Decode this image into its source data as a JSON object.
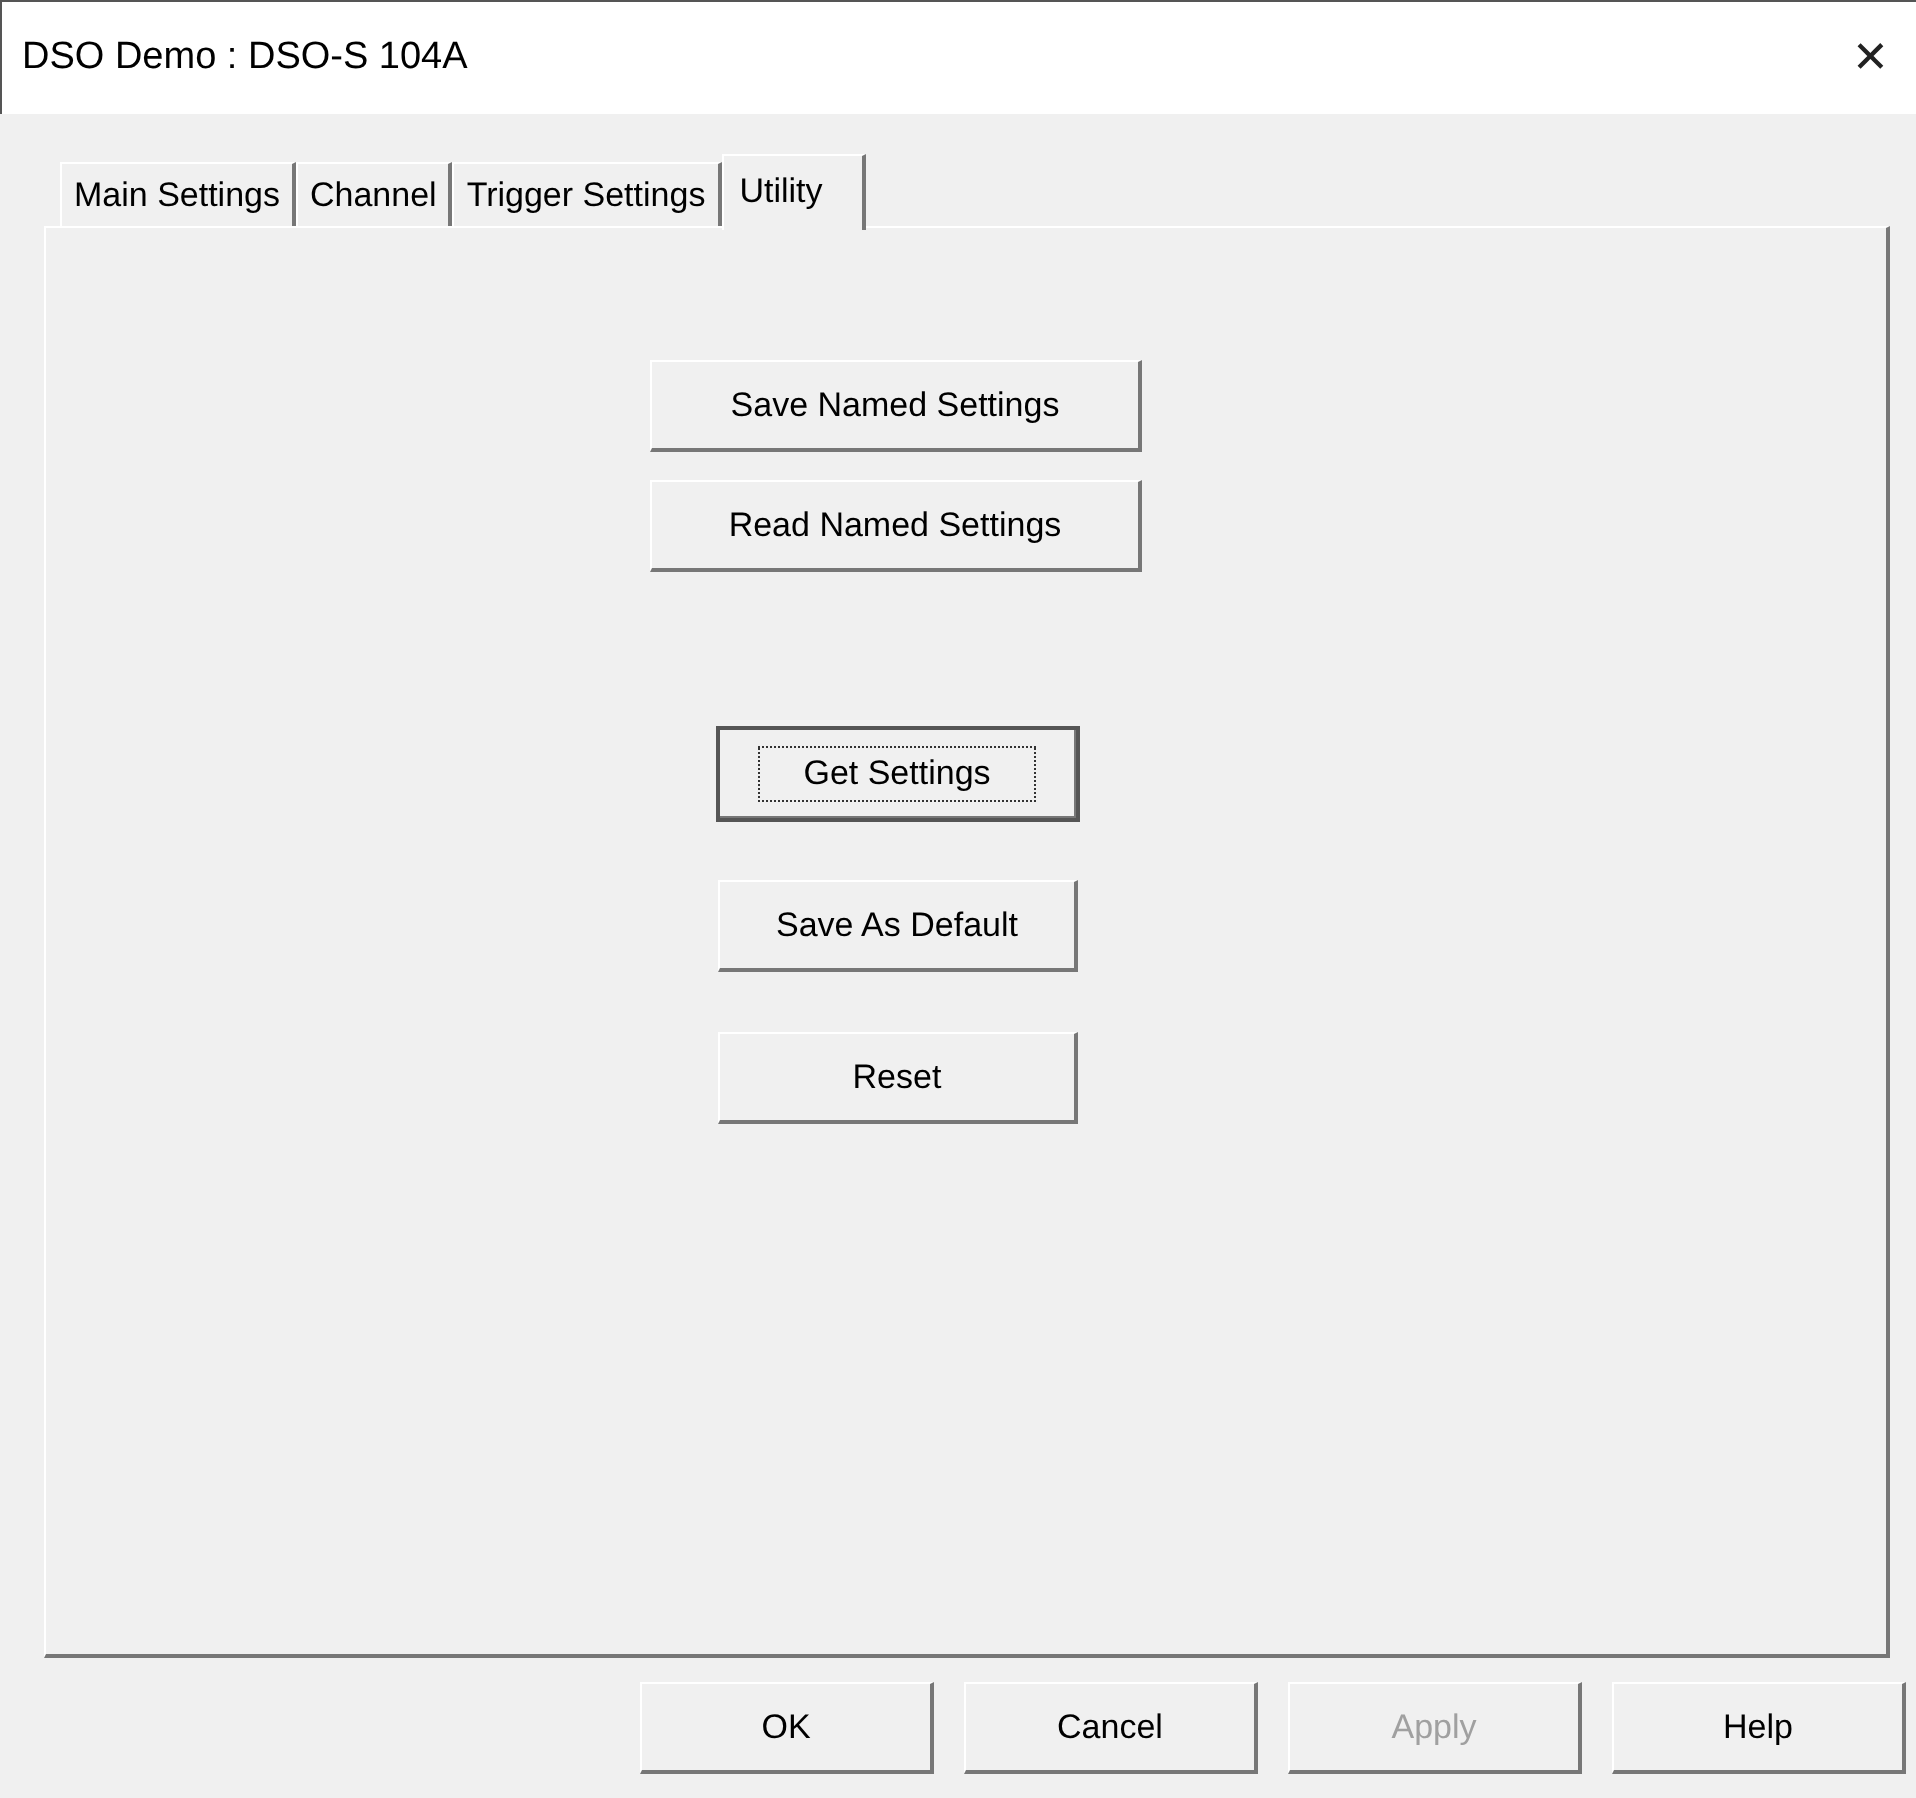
{
  "window": {
    "title": "DSO Demo : DSO-S 104A",
    "close": "✕"
  },
  "tabs": [
    {
      "label": "Main Settings",
      "selected": false
    },
    {
      "label": "Channel",
      "selected": false
    },
    {
      "label": "Trigger Settings",
      "selected": false
    },
    {
      "label": "Utility",
      "selected": true
    }
  ],
  "panel_buttons": [
    {
      "label": "Save Named Settings",
      "kind": "wide",
      "focused": false
    },
    {
      "label": "Read Named Settings",
      "kind": "wide",
      "focused": false
    },
    {
      "label": "Get Settings",
      "kind": "narrow",
      "focused": true
    },
    {
      "label": "Save As Default",
      "kind": "narrow",
      "focused": false
    },
    {
      "label": "Reset",
      "kind": "narrow",
      "focused": false
    }
  ],
  "dialog_buttons": [
    {
      "label": "OK",
      "disabled": false
    },
    {
      "label": "Cancel",
      "disabled": false
    },
    {
      "label": "Apply",
      "disabled": true
    },
    {
      "label": "Help",
      "disabled": false
    }
  ]
}
